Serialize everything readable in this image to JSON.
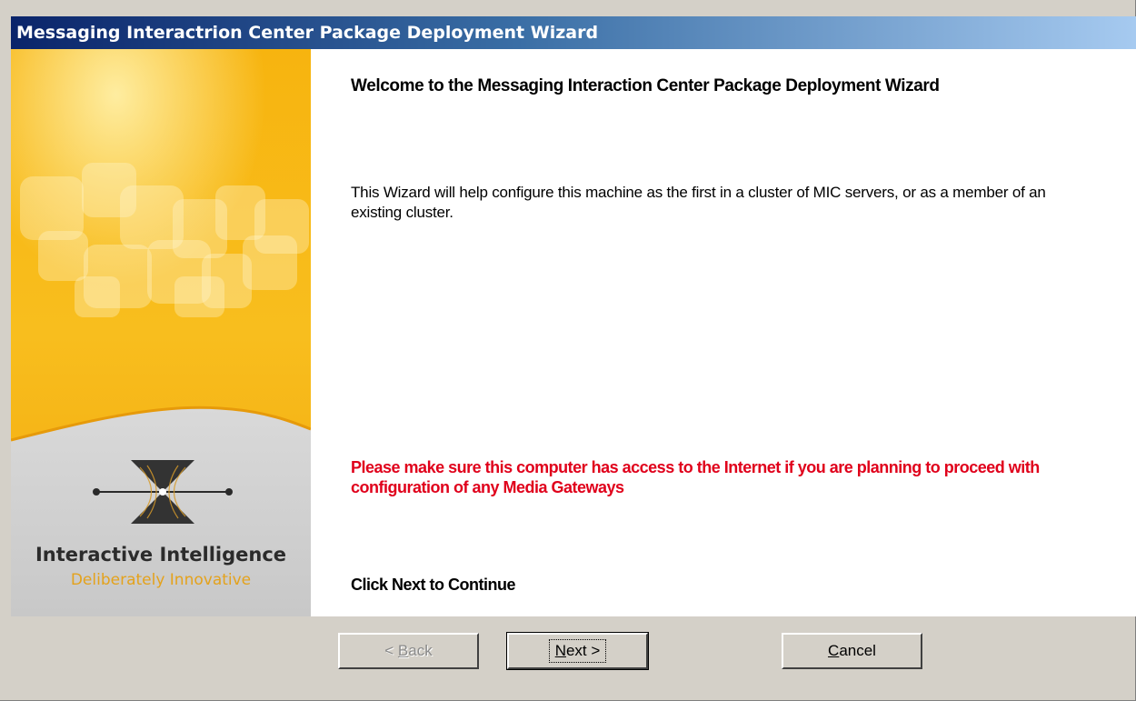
{
  "window": {
    "title": "Messaging Interactrion Center Package Deployment Wizard"
  },
  "banner": {
    "brand_name": "Interactive Intelligence",
    "brand_tagline": "Deliberately Innovative"
  },
  "main": {
    "welcome_title": "Welcome to the Messaging Interaction Center Package Deployment Wizard",
    "description": "This Wizard will help configure this machine as the first in a cluster of MIC servers, or as a member of an existing cluster.",
    "warning": "Please make sure this computer has access to the Internet if you are planning to proceed with configuration of any Media Gateways",
    "instruction": "Click Next to Continue"
  },
  "buttons": {
    "back": {
      "prefix": "< ",
      "mnemonic": "B",
      "rest": "ack",
      "enabled": false
    },
    "next": {
      "prefix": "",
      "mnemonic": "N",
      "rest": "ext >",
      "enabled": true
    },
    "cancel": {
      "prefix": "",
      "mnemonic": "C",
      "rest": "ancel",
      "enabled": true
    }
  },
  "colors": {
    "title_gradient_start": "#0a246a",
    "title_gradient_end": "#a6caf0",
    "warning_text": "#e0001b",
    "banner_orange": "#f5b312",
    "tagline_orange": "#e4a21c",
    "dialog_face": "#d4d0c8"
  },
  "icons": {
    "logo": "interactive-intelligence-logo-icon"
  }
}
